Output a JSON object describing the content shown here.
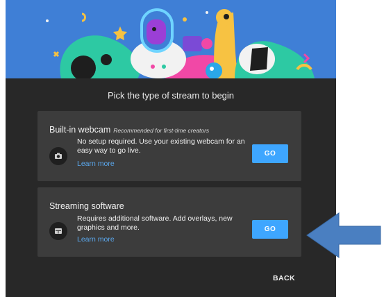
{
  "dialog": {
    "heading": "Pick the type of stream to begin",
    "cards": [
      {
        "title": "Built-in webcam",
        "tag": "Recommended for first-time creators",
        "description": "No setup required. Use your existing webcam for an easy way to go live.",
        "learn_more": "Learn more",
        "button": "GO",
        "icon": "camera-icon"
      },
      {
        "title": "Streaming software",
        "tag": "",
        "description": "Requires additional software. Add overlays, new graphics and more.",
        "learn_more": "Learn more",
        "button": "GO",
        "icon": "encoder-icon"
      }
    ],
    "back": "BACK"
  },
  "colors": {
    "dialog_bg": "#282828",
    "card_bg": "#3c3c3c",
    "accent": "#3ea6ff",
    "link": "#5aa7ec",
    "banner_bg": "#3f7fd6",
    "annotation_arrow": "#4a7fc1"
  },
  "annotation": {
    "icon": "arrow-left-icon"
  }
}
